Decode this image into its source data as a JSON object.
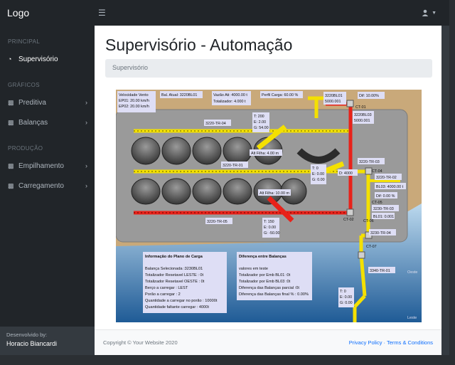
{
  "app": {
    "brand": "Logo"
  },
  "sidebar": {
    "sections": [
      {
        "heading": "PRINCIPAL",
        "items": [
          {
            "label": "Supervisório",
            "icon": "gauge-icon",
            "active": true
          }
        ]
      },
      {
        "heading": "GRÁFICOS",
        "items": [
          {
            "label": "Preditiva",
            "icon": "chart-icon"
          },
          {
            "label": "Balanças",
            "icon": "chart-icon"
          }
        ]
      },
      {
        "heading": "PRODUÇÃO",
        "items": [
          {
            "label": "Empilhamento",
            "icon": "chart-icon"
          },
          {
            "label": "Carregamento",
            "icon": "chart-icon"
          }
        ]
      }
    ],
    "footer": {
      "dev_label": "Desenvolvido by:",
      "dev_name": "Horacio Biancardi"
    }
  },
  "page": {
    "title": "Supervisório - Automação",
    "breadcrumb": "Supervisório"
  },
  "footer": {
    "copyright": "Copyright © Your Website 2020",
    "links": "Privacy Policy · Terms & Conditions"
  },
  "scada": {
    "top_labels": {
      "vento1": "Velocidade Vento",
      "vento2": "EP01: 20.00 km/h",
      "vento3": "EP02: 20.00 km/h",
      "bal": "Bal. Atual: 3220BL01",
      "vazao1": "Vazão Ati: 4000.00 t",
      "vazao2": "Totalizador: 4.000 t",
      "perfil": "Perfil Carga: 60.00 %",
      "bl01a": "3220BL01",
      "bl01b": "5000.001",
      "dif": "Dif: 10.00%"
    },
    "mid_labels": {
      "ct01": "CT-01",
      "bl03a": "3220BL03",
      "bl03b": "5000.001",
      "tr04": "3220-TR-04",
      "t200": "T: 200",
      "e200": "E: 2.00",
      "g5400": "G: 54.00",
      "alt1": "Alt Filha: 4.00 m",
      "tr01": "3220-TR-01",
      "tr03": "3220-TR-03",
      "t0a": "T: 0",
      "e0a": "E: 0.00",
      "g0a": "G: 0.00",
      "d4000": "D: 4000",
      "ct04": "CT-04",
      "tr02": "3220-TR-02",
      "bl03c": "BL03: 4000.00 t",
      "dif0": "Dif: 0.00 %",
      "ct05": "CT-05",
      "tr03b": "3230-TR-03",
      "alt2": "Alt Filha: 10.00 m",
      "bl01c": "BL01: 0.001",
      "ct02": "CT-02",
      "ct06": "CT-06",
      "tr05": "3220-TR-05",
      "t150": "T: 150",
      "e000": "E: 0.00",
      "gm50": "G: -50.00",
      "tr04b": "3230-TR-04",
      "ct07": "CT-07",
      "tr01b": "3340-TR-01",
      "t0b": "T: 0",
      "e0b": "E: 0.00",
      "g0b": "G: 0.00",
      "oeste": "Oeste",
      "leste": "Leste"
    },
    "info_plano": {
      "title": "Informação do Plano de Carga",
      "lines": [
        "Balança Selecionada :3230BL01",
        "Totalizador Resetavel LESTE : 0t",
        "Totalizador Resetavel OESTE : 0t",
        "Berço a carregar : LEST",
        "Porão a carregar : 2",
        "Quantidade a carregar no porão : 10000t",
        "Quantidade faltante carregar : 4000t"
      ]
    },
    "info_balancas": {
      "title": "Diferença entre Balanças",
      "lines": [
        "valores em teste",
        "Totalizador por Emb BL01 :0t",
        "Totalizador por Emb BL03 :0t",
        "Diferença das Balanças parcial :0t",
        "Diferença das Balanças final % : 0.00%"
      ]
    }
  }
}
